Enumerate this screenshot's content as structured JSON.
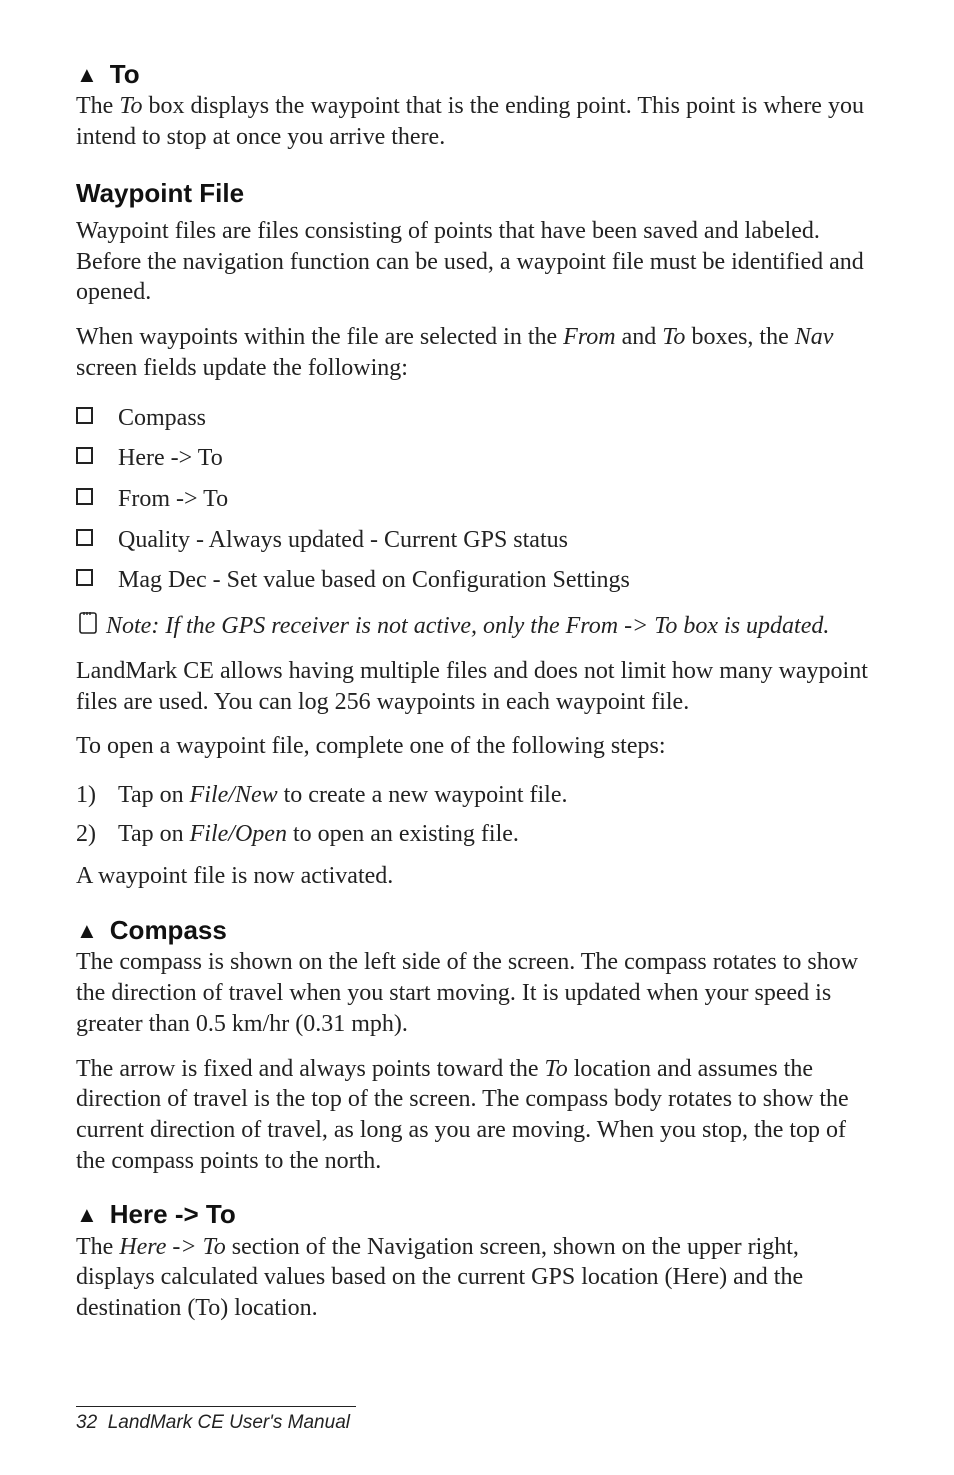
{
  "sections": {
    "to": {
      "heading": "To",
      "body": "The To box displays the waypoint that is the ending point. This point is where you intend to stop at once you arrive there."
    },
    "waypointFile": {
      "heading": "Waypoint File",
      "p1": "Waypoint files are files consisting of points that have been saved and labeled. Before the navigation function can be used, a waypoint file must be identified and opened.",
      "p2_pre": "When waypoints within the file are selected in the ",
      "p2_from": "From",
      "p2_mid": " and ",
      "p2_to": "To",
      "p2_post": " boxes, the ",
      "p2_nav": "Nav",
      "p2_end": " screen fields update the following:",
      "bullets": {
        "b0": "Compass",
        "b1": "Here -> To",
        "b2": "From -> To",
        "b3": "Quality - Always updated - Current GPS status",
        "b4": "Mag Dec - Set value based on Configuration Settings"
      },
      "note": "Note: If the GPS receiver is not active, only the From -> To box is updated.",
      "p3": "LandMark CE allows having multiple files and does not limit how many waypoint files are used. You can log 256 waypoints in each waypoint file.",
      "p4": "To open a waypoint file, complete one of the following steps:",
      "steps": {
        "s1_num": "1)",
        "s1_pre": "Tap on ",
        "s1_em": "File/New",
        "s1_post": " to create a new waypoint file.",
        "s2_num": "2)",
        "s2_pre": "Tap on ",
        "s2_em": "File/Open",
        "s2_post": " to open an existing file."
      },
      "p5": "A waypoint file is now activated."
    },
    "compass": {
      "heading": "Compass",
      "p1": "The compass is shown on the left side of the screen. The compass rotates to show the direction of travel when you start moving. It is updated when your speed is greater than 0.5 km/hr (0.31 mph).",
      "p2_pre": "The arrow is fixed and always points toward the ",
      "p2_em": "To",
      "p2_post": " location and assumes the direction of travel is the top of the screen. The compass body rotates to show the current direction of travel, as long as you are moving. When you stop, the top of the compass points to the north."
    },
    "hereTo": {
      "heading": "Here -> To",
      "p1_pre": "The ",
      "p1_em": "Here -> To",
      "p1_post": " section of the Navigation screen, shown on the upper right, displays calculated values based on the current GPS location (Here) and the destination (To) location."
    }
  },
  "footer": {
    "pageNum": "32",
    "title": "LandMark CE User's Manual"
  }
}
